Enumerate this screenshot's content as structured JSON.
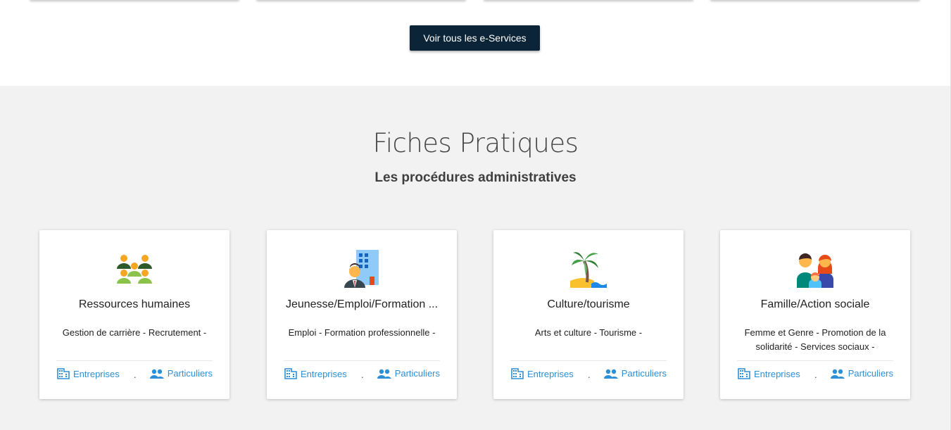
{
  "top": {
    "cta_label": "Voir tous les e-Services"
  },
  "section": {
    "title": "Fiches Pratiques",
    "subtitle": "Les procédures administratives"
  },
  "cards": [
    {
      "icon": "team-people-icon",
      "title": "Ressources humaines",
      "desc": "Gestion de carrière - Recrutement -",
      "link_ent": "Entreprises",
      "separator": ".",
      "link_part": "Particuliers"
    },
    {
      "icon": "businessman-building-icon",
      "title": "Jeunesse/Emploi/Formation ...",
      "desc": "Emploi - Formation professionnelle -",
      "link_ent": "Entreprises",
      "separator": ".",
      "link_part": "Particuliers"
    },
    {
      "icon": "palm-tree-beach-icon",
      "title": "Culture/tourisme",
      "desc": "Arts et culture - Tourisme -",
      "link_ent": "Entreprises",
      "separator": ".",
      "link_part": "Particuliers"
    },
    {
      "icon": "family-icon",
      "title": "Famille/Action sociale",
      "desc": "Femme et Genre - Promotion de la solidarité - Services sociaux -",
      "link_ent": "Entreprises",
      "separator": ".",
      "link_part": "Particuliers"
    }
  ],
  "colors": {
    "cta_bg": "#0b2437",
    "section_bg": "#f2f2f2",
    "link": "#2d8fd5"
  }
}
